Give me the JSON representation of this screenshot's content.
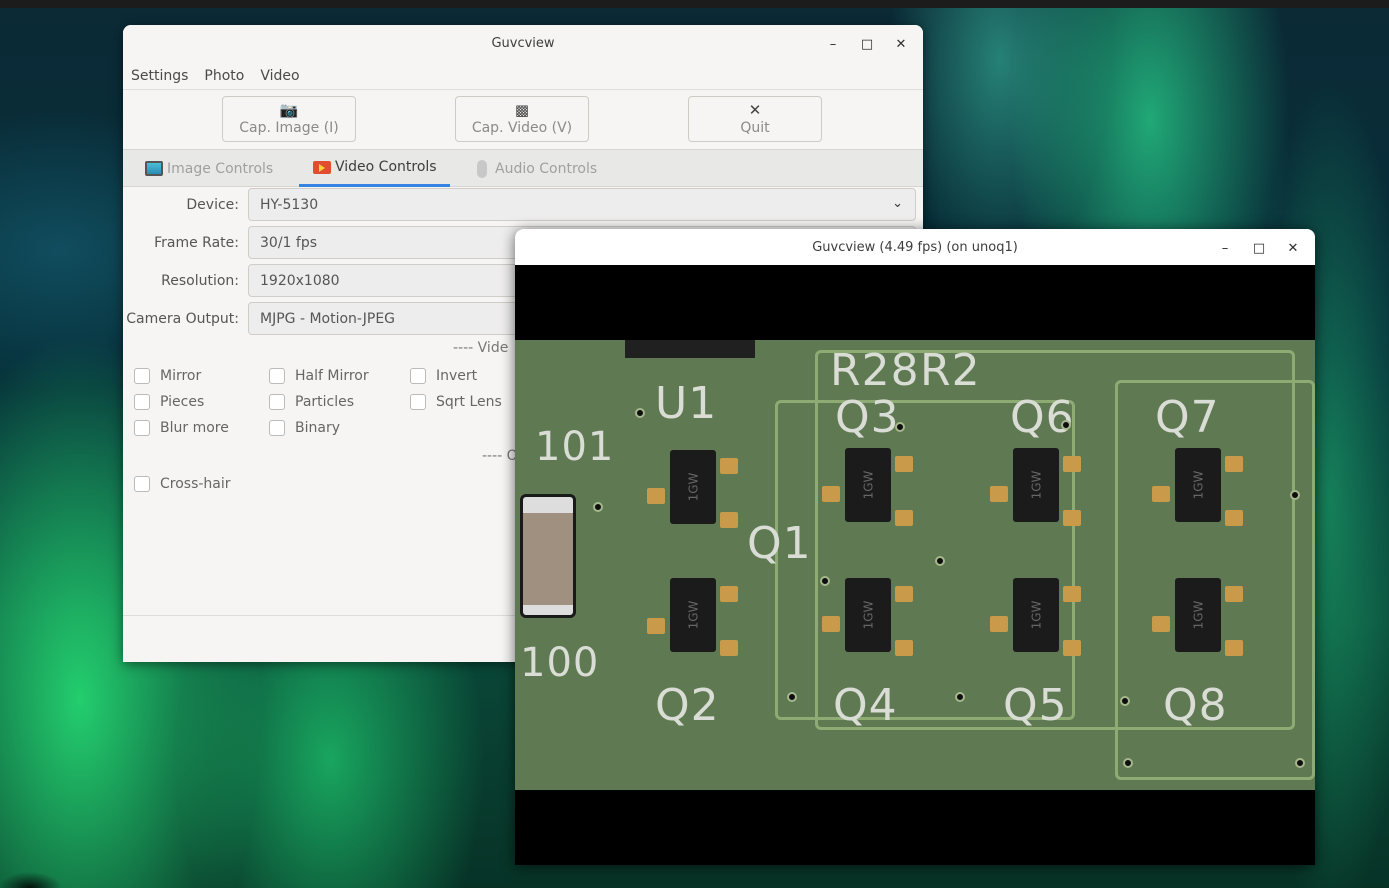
{
  "main_window": {
    "title": "Guvcview",
    "menu": [
      "Settings",
      "Photo",
      "Video"
    ],
    "toolbar": {
      "cap_image_label": "Cap. Image (I)",
      "cap_video_label": "Cap. Video (V)",
      "quit_label": "Quit"
    },
    "tabs": {
      "image": "Image Controls",
      "video": "Video Controls",
      "audio": "Audio Controls",
      "active": "Video Controls"
    },
    "fields": {
      "device_label": "Device:",
      "device_value": "HY-5130",
      "frame_rate_label": "Frame Rate:",
      "frame_rate_value": "30/1 fps",
      "resolution_label": "Resolution:",
      "resolution_value": "1920x1080",
      "camera_output_label": "Camera Output:",
      "camera_output_value": "MJPG - Motion-JPEG"
    },
    "filters_header": "---- Vide",
    "filters": [
      "Mirror",
      "Half Mirror",
      "Invert",
      "Pieces",
      "Particles",
      "Sqrt Lens",
      "Blur more",
      "Binary"
    ],
    "osd_header": "---- O",
    "osd_items": [
      "Cross-hair"
    ]
  },
  "preview_window": {
    "title": "Guvcview  (4.49 fps) (on unoq1)",
    "pcb_labels": [
      "U1",
      "R28",
      "R2",
      "Q3",
      "Q6",
      "Q7",
      "Q1",
      "Q2",
      "Q4",
      "Q5",
      "Q8",
      "101",
      "100"
    ],
    "chip_marking": "1GW"
  },
  "accent_color": "#3584e4"
}
